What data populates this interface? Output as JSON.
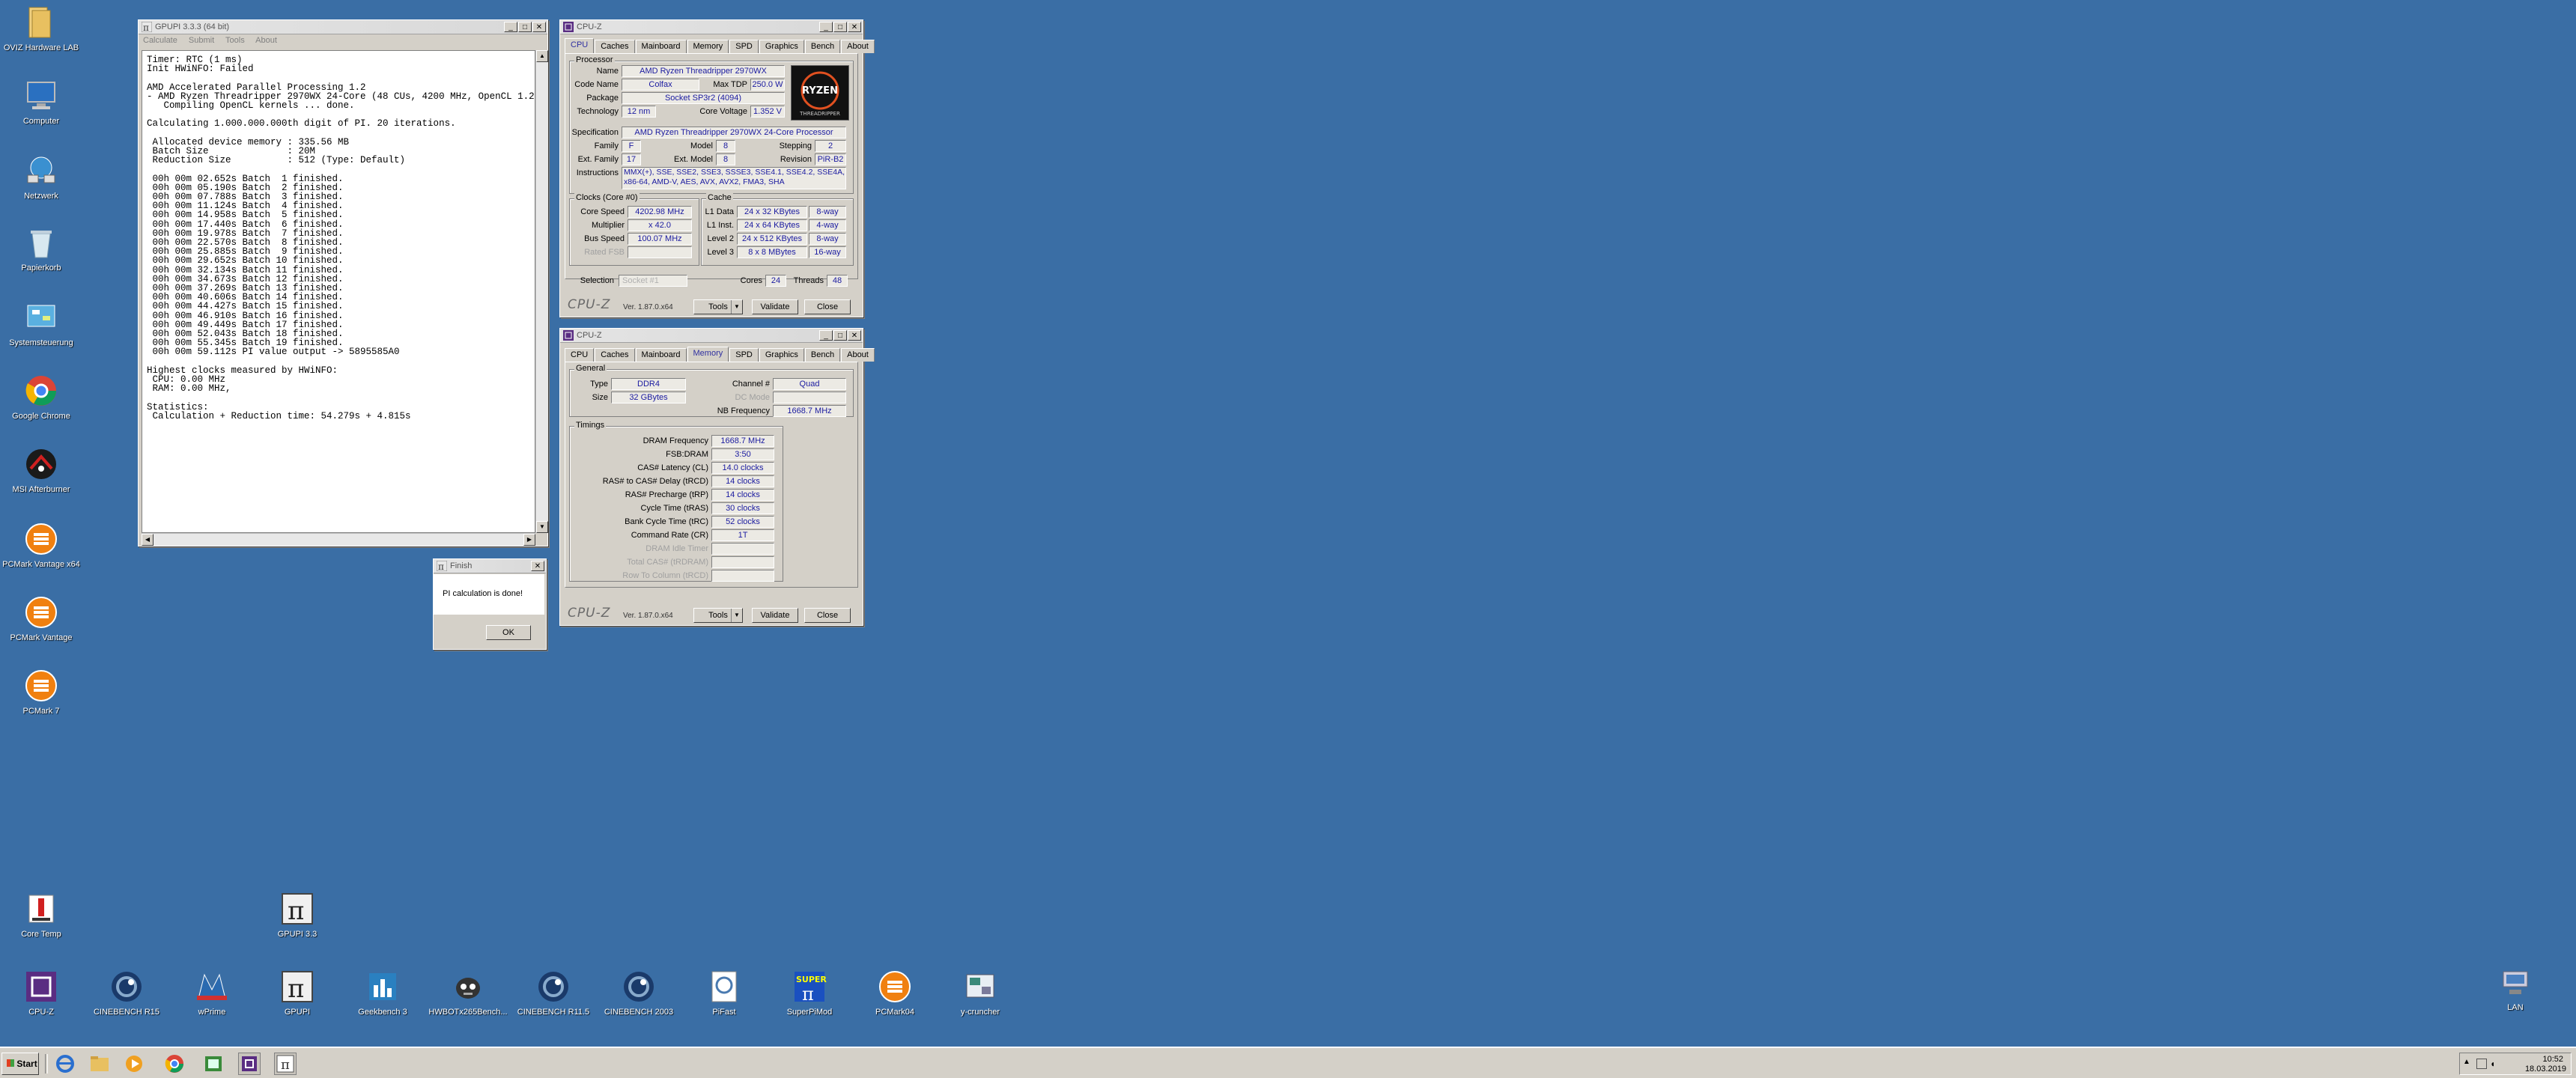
{
  "desktop_icons": [
    {
      "label": "OVIZ Hardware LAB",
      "icon": "folder-icon"
    },
    {
      "label": "Computer",
      "icon": "computer-icon"
    },
    {
      "label": "Netzwerk",
      "icon": "network-icon"
    },
    {
      "label": "Papierkorb",
      "icon": "recycle-bin-icon"
    },
    {
      "label": "Systemsteuerung",
      "icon": "control-panel-icon"
    },
    {
      "label": "Google Chrome",
      "icon": "chrome-icon"
    },
    {
      "label": "MSI Afterburner",
      "icon": "afterburner-icon"
    },
    {
      "label": "PCMark Vantage x64",
      "icon": "pcmark-icon"
    },
    {
      "label": "PCMark Vantage",
      "icon": "pcmark-icon"
    },
    {
      "label": "PCMark 7",
      "icon": "pcmark-icon"
    },
    {
      "label": "Core Temp",
      "icon": "coretemp-icon"
    },
    {
      "label": "GPUPI 3.3",
      "icon": "pi-icon"
    },
    {
      "label": "LAN",
      "icon": "network-drive-icon"
    }
  ],
  "bottom_icons": [
    {
      "label": "CPU-Z",
      "icon": "cpuz-icon"
    },
    {
      "label": "CINEBENCH R15",
      "icon": "cinebench-icon"
    },
    {
      "label": "wPrime",
      "icon": "wprime-icon"
    },
    {
      "label": "GPUPI",
      "icon": "pi-icon"
    },
    {
      "label": "Geekbench 3",
      "icon": "geekbench-icon"
    },
    {
      "label": "HWBOTx265Bench...",
      "icon": "hwbot-icon"
    },
    {
      "label": "CINEBENCH R11.5",
      "icon": "cinebench-icon"
    },
    {
      "label": "CINEBENCH 2003",
      "icon": "cinebench-icon"
    },
    {
      "label": "PiFast",
      "icon": "pifast-icon"
    },
    {
      "label": "SuperPiMod",
      "icon": "superpi-icon"
    },
    {
      "label": "PCMark04",
      "icon": "pcmark-icon"
    },
    {
      "label": "y-cruncher",
      "icon": "ycruncher-icon"
    }
  ],
  "gpupi": {
    "title": "GPUPI 3.3.3 (64 bit)",
    "menu": [
      "Calculate",
      "Submit",
      "Tools",
      "About"
    ],
    "lines": [
      "Timer: RTC (1 ms)",
      "Init HWiNFO: Failed",
      "",
      "AMD Accelerated Parallel Processing 1.2",
      "- AMD Ryzen Threadripper 2970WX 24-Core (48 CUs, 4200 MHz, OpenCL 1.2)",
      "   Compiling OpenCL kernels ... done.",
      "",
      "Calculating 1.000.000.000th digit of PI. 20 iterations.",
      "",
      " Allocated device memory : 335.56 MB",
      " Batch Size              : 20M",
      " Reduction Size          : 512 (Type: Default)",
      "",
      " 00h 00m 02.652s Batch  1 finished.",
      " 00h 00m 05.190s Batch  2 finished.",
      " 00h 00m 07.788s Batch  3 finished.",
      " 00h 00m 11.124s Batch  4 finished.",
      " 00h 00m 14.958s Batch  5 finished.",
      " 00h 00m 17.440s Batch  6 finished.",
      " 00h 00m 19.978s Batch  7 finished.",
      " 00h 00m 22.570s Batch  8 finished.",
      " 00h 00m 25.885s Batch  9 finished.",
      " 00h 00m 29.652s Batch 10 finished.",
      " 00h 00m 32.134s Batch 11 finished.",
      " 00h 00m 34.673s Batch 12 finished.",
      " 00h 00m 37.269s Batch 13 finished.",
      " 00h 00m 40.606s Batch 14 finished.",
      " 00h 00m 44.427s Batch 15 finished.",
      " 00h 00m 46.910s Batch 16 finished.",
      " 00h 00m 49.449s Batch 17 finished.",
      " 00h 00m 52.043s Batch 18 finished.",
      " 00h 00m 55.345s Batch 19 finished.",
      " 00h 00m 59.112s PI value output -> 5895585A0",
      "",
      "Highest clocks measured by HWiNFO:",
      " CPU: 0.00 MHz",
      " RAM: 0.00 MHz,",
      "",
      "Statistics:",
      " Calculation + Reduction time: 54.279s + 4.815s"
    ]
  },
  "finish_dialog": {
    "title": "Finish",
    "message": "PI calculation is done!",
    "ok_label": "OK"
  },
  "cpuz_cpu": {
    "title": "CPU-Z",
    "tabs": [
      "CPU",
      "Caches",
      "Mainboard",
      "Memory",
      "SPD",
      "Graphics",
      "Bench",
      "About"
    ],
    "active_tab": "CPU",
    "processor_group": "Processor",
    "name_label": "Name",
    "name": "AMD Ryzen Threadripper 2970WX",
    "codename_label": "Code Name",
    "codename": "Colfax",
    "maxtdp_label": "Max TDP",
    "maxtdp": "250.0 W",
    "package_label": "Package",
    "package": "Socket SP3r2 (4094)",
    "technology_label": "Technology",
    "technology": "12 nm",
    "corevoltage_label": "Core Voltage",
    "corevoltage": "1.352 V",
    "spec_label": "Specification",
    "spec": "AMD Ryzen Threadripper 2970WX 24-Core Processor",
    "family_label": "Family",
    "family": "F",
    "model_label": "Model",
    "model": "8",
    "stepping_label": "Stepping",
    "stepping": "2",
    "extfamily_label": "Ext. Family",
    "extfamily": "17",
    "extmodel_label": "Ext. Model",
    "extmodel": "8",
    "revision_label": "Revision",
    "revision": "PiR-B2",
    "instructions_label": "Instructions",
    "instructions_1": "MMX(+), SSE, SSE2, SSE3, SSSE3, SSE4.1, SSE4.2, SSE4A,",
    "instructions_2": "x86-64, AMD-V, AES, AVX, AVX2, FMA3, SHA",
    "logo_top": "RYZEN",
    "logo_bottom": "THREADRIPPER",
    "clocks_group": "Clocks (Core #0)",
    "corespeed_label": "Core Speed",
    "corespeed": "4202.98 MHz",
    "multiplier_label": "Multiplier",
    "multiplier": "x 42.0",
    "busspeed_label": "Bus Speed",
    "busspeed": "100.07 MHz",
    "ratedfsb_label": "Rated FSB",
    "ratedfsb": "",
    "cache_group": "Cache",
    "l1data_label": "L1 Data",
    "l1data": "24 x 32 KBytes",
    "l1data_way": "8-way",
    "l1inst_label": "L1 Inst.",
    "l1inst": "24 x 64 KBytes",
    "l1inst_way": "4-way",
    "level2_label": "Level 2",
    "level2": "24 x 512 KBytes",
    "level2_way": "8-way",
    "level3_label": "Level 3",
    "level3": "8 x 8 MBytes",
    "level3_way": "16-way",
    "selection_label": "Selection",
    "selection": "Socket #1",
    "cores_label": "Cores",
    "cores": "24",
    "threads_label": "Threads",
    "threads": "48",
    "version": "Ver. 1.87.0.x64",
    "logo": "CPU-Z",
    "tools_label": "Tools",
    "validate_label": "Validate",
    "close_label": "Close"
  },
  "cpuz_mem": {
    "title": "CPU-Z",
    "tabs": [
      "CPU",
      "Caches",
      "Mainboard",
      "Memory",
      "SPD",
      "Graphics",
      "Bench",
      "About"
    ],
    "active_tab": "Memory",
    "general_group": "General",
    "type_label": "Type",
    "type": "DDR4",
    "channel_label": "Channel #",
    "channel": "Quad",
    "size_label": "Size",
    "size": "32 GBytes",
    "dcmode_label": "DC Mode",
    "dcmode": "",
    "nbfreq_label": "NB Frequency",
    "nbfreq": "1668.7 MHz",
    "timings_group": "Timings",
    "timings": [
      {
        "label": "DRAM Frequency",
        "value": "1668.7 MHz",
        "disabled": false
      },
      {
        "label": "FSB:DRAM",
        "value": "3:50",
        "disabled": false
      },
      {
        "label": "CAS# Latency (CL)",
        "value": "14.0 clocks",
        "disabled": false
      },
      {
        "label": "RAS# to CAS# Delay (tRCD)",
        "value": "14 clocks",
        "disabled": false
      },
      {
        "label": "RAS# Precharge (tRP)",
        "value": "14 clocks",
        "disabled": false
      },
      {
        "label": "Cycle Time (tRAS)",
        "value": "30 clocks",
        "disabled": false
      },
      {
        "label": "Bank Cycle Time (tRC)",
        "value": "52 clocks",
        "disabled": false
      },
      {
        "label": "Command Rate (CR)",
        "value": "1T",
        "disabled": false
      },
      {
        "label": "DRAM Idle Timer",
        "value": "",
        "disabled": true
      },
      {
        "label": "Total CAS# (tRDRAM)",
        "value": "",
        "disabled": true
      },
      {
        "label": "Row To Column (tRCD)",
        "value": "",
        "disabled": true
      }
    ],
    "version": "Ver. 1.87.0.x64",
    "logo": "CPU-Z",
    "tools_label": "Tools",
    "validate_label": "Validate",
    "close_label": "Close"
  },
  "taskbar": {
    "start_label": "Start",
    "time": "10:52",
    "date": "18.03.2019"
  }
}
